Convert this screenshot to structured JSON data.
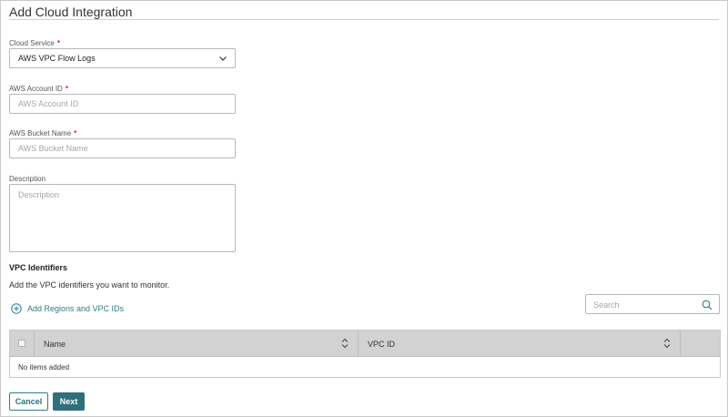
{
  "page": {
    "title": "Add Cloud Integration"
  },
  "form": {
    "cloud_service": {
      "label": "Cloud Service",
      "required_mark": "*",
      "value": "AWS VPC Flow Logs"
    },
    "account_id": {
      "label": "AWS Account ID",
      "required_mark": "*",
      "placeholder": "AWS Account ID",
      "value": ""
    },
    "bucket_name": {
      "label": "AWS Bucket Name",
      "required_mark": "*",
      "placeholder": "AWS Bucket Name",
      "value": ""
    },
    "description": {
      "label": "Description",
      "placeholder": "Description",
      "value": ""
    }
  },
  "vpc": {
    "title": "VPC Identifiers",
    "description": "Add the VPC identifiers you want to monitor.",
    "add_label": "Add Regions and VPC IDs",
    "search_placeholder": "Search"
  },
  "table": {
    "columns": [
      "Name",
      "VPC ID"
    ],
    "empty_text": "No items added"
  },
  "actions": {
    "cancel_label": "Cancel",
    "next_label": "Next"
  },
  "colors": {
    "accent": "#316f7c",
    "required": "#d9272e",
    "link": "#2f7d8a",
    "header_bg": "#d2d2d2"
  },
  "icons": {
    "select": "chevron-down-icon",
    "add": "plus-circle-icon",
    "search": "search-icon",
    "sort": "sort-icon"
  }
}
